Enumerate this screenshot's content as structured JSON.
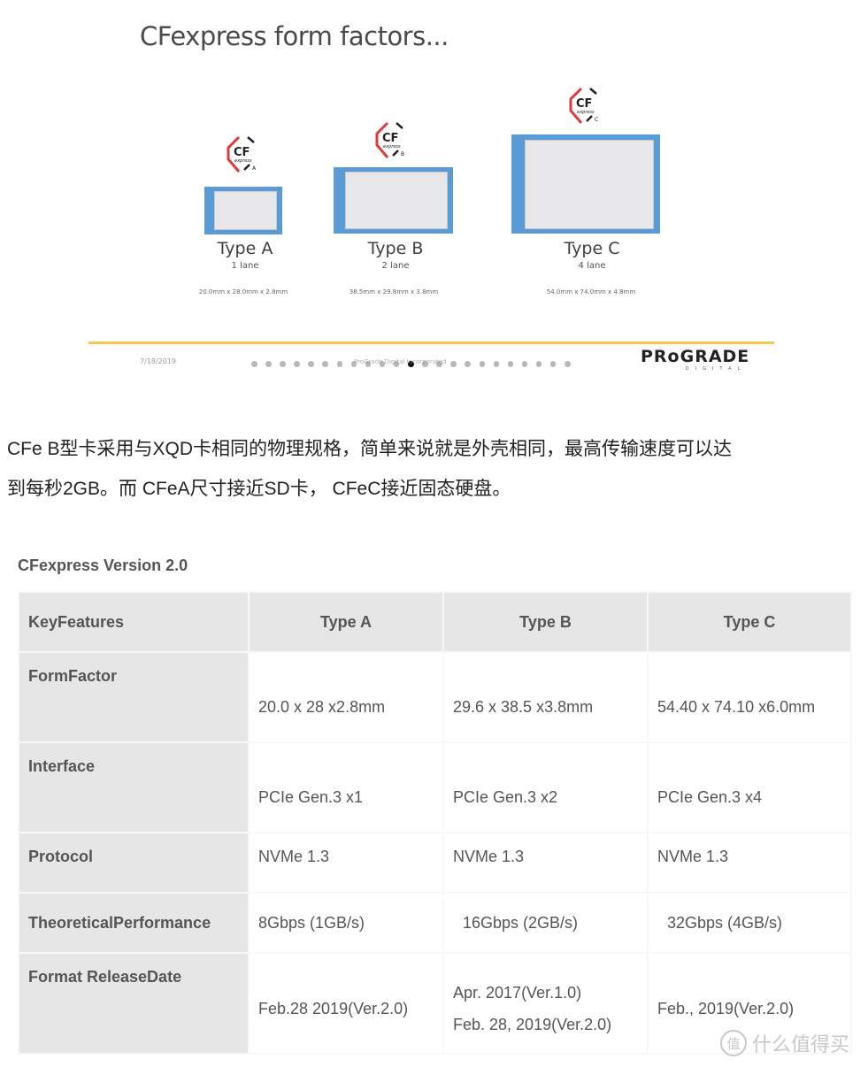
{
  "slide": {
    "title": "CFexpress form factors...",
    "cards": [
      {
        "logo_text": "CF",
        "logo_sub": "express",
        "logo_letter": "A",
        "type": "Type A",
        "lanes": "1 lane",
        "dimensions": "20.0mm x 28.0mm x 2.8mm"
      },
      {
        "logo_text": "CF",
        "logo_sub": "express",
        "logo_letter": "B",
        "type": "Type B",
        "lanes": "2 lane",
        "dimensions": "38.5mm x 29.8mm x 3.8mm"
      },
      {
        "logo_text": "CF",
        "logo_sub": "express",
        "logo_letter": "C",
        "type": "Type C",
        "lanes": "4 lane",
        "dimensions": "54.0mm x 74.0mm x 4.8mm"
      }
    ],
    "date": "7/18/2019",
    "footer_text": "ProGrade Digital Incorporated",
    "page_dots_total": 23,
    "page_dots_active_index": 11,
    "brand": {
      "name": "PRoGRADE",
      "sub": "DIGITAL"
    },
    "colors": {
      "card_frame": "#5b9bd5",
      "card_inner": "#e7e6e8",
      "accent_line": "#f2c94c",
      "logo_red": "#e03a3a"
    }
  },
  "paragraph": {
    "line1": "CFe B型卡采用与XQD卡相同的物理规格，简单来说就是外壳相同，最高传输速度可以达",
    "line2": "到每秒2GB。而 CFeA尺寸接近SD卡， CFeC接近固态硬盘。"
  },
  "table": {
    "title": "CFexpress Version 2.0",
    "headers": [
      "KeyFeatures",
      "Type A",
      "Type B",
      "Type C"
    ],
    "rows": [
      {
        "label": "FormFactor",
        "a": "20.0 x 28 x2.8mm",
        "b": "29.6 x 38.5 x3.8mm",
        "c": "54.40 x 74.10 x6.0mm"
      },
      {
        "label": "Interface",
        "a": "PCIe Gen.3 x1",
        "b": "PCIe Gen.3 x2",
        "c": "PCIe Gen.3 x4"
      },
      {
        "label": "Protocol",
        "a": "NVMe 1.3",
        "b": "NVMe 1.3",
        "c": "NVMe 1.3"
      },
      {
        "label": "TheoreticalPerformance",
        "a": "8Gbps (1GB/s)",
        "b": "16Gbps (2GB/s)",
        "c": "32Gbps (4GB/s)"
      },
      {
        "label": "Format ReleaseDate",
        "a": "Feb.28 2019(Ver.2.0)",
        "b1": "Apr. 2017(Ver.1.0)",
        "b2": "Feb. 28, 2019(Ver.2.0)",
        "c": "Feb., 2019(Ver.2.0)"
      }
    ]
  },
  "watermark": {
    "icon_char": "值",
    "text": "什么值得买"
  }
}
